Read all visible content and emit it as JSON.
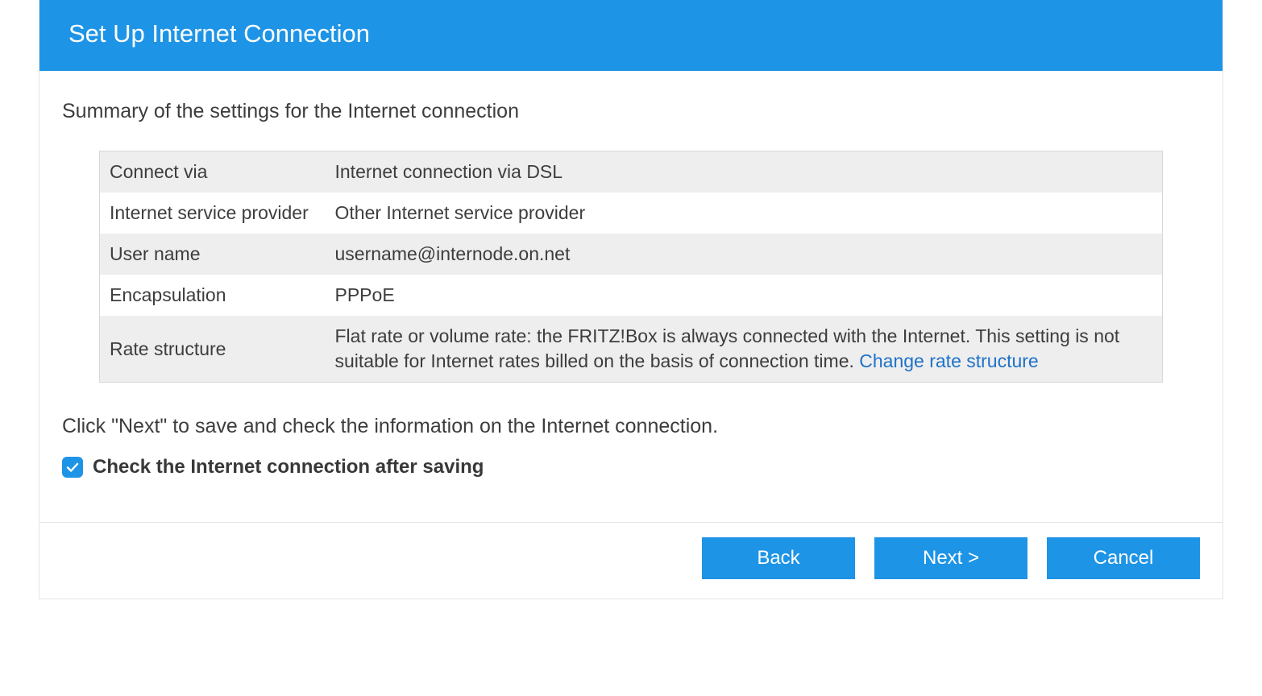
{
  "header": {
    "title": "Set Up Internet Connection"
  },
  "summary": {
    "heading": "Summary of the settings for the Internet connection",
    "rows": {
      "connect_via": {
        "label": "Connect via",
        "value": "Internet connection via DSL"
      },
      "isp": {
        "label": "Internet service provider",
        "value": "Other Internet service provider"
      },
      "user_name": {
        "label": "User name",
        "value": "username@internode.on.net"
      },
      "encapsulation": {
        "label": "Encapsulation",
        "value": "PPPoE"
      },
      "rate_structure": {
        "label": "Rate structure",
        "value": "Flat rate or volume rate: the FRITZ!Box is always connected with the Internet. This setting is not suitable for Internet rates billed on the basis of connection time. ",
        "link_text": "Change rate structure"
      }
    }
  },
  "instruction": "Click \"Next\" to save and check the information on the Internet connection.",
  "checkbox": {
    "label": "Check the Internet connection after saving",
    "checked": true
  },
  "buttons": {
    "back": "Back",
    "next": "Next >",
    "cancel": "Cancel"
  }
}
